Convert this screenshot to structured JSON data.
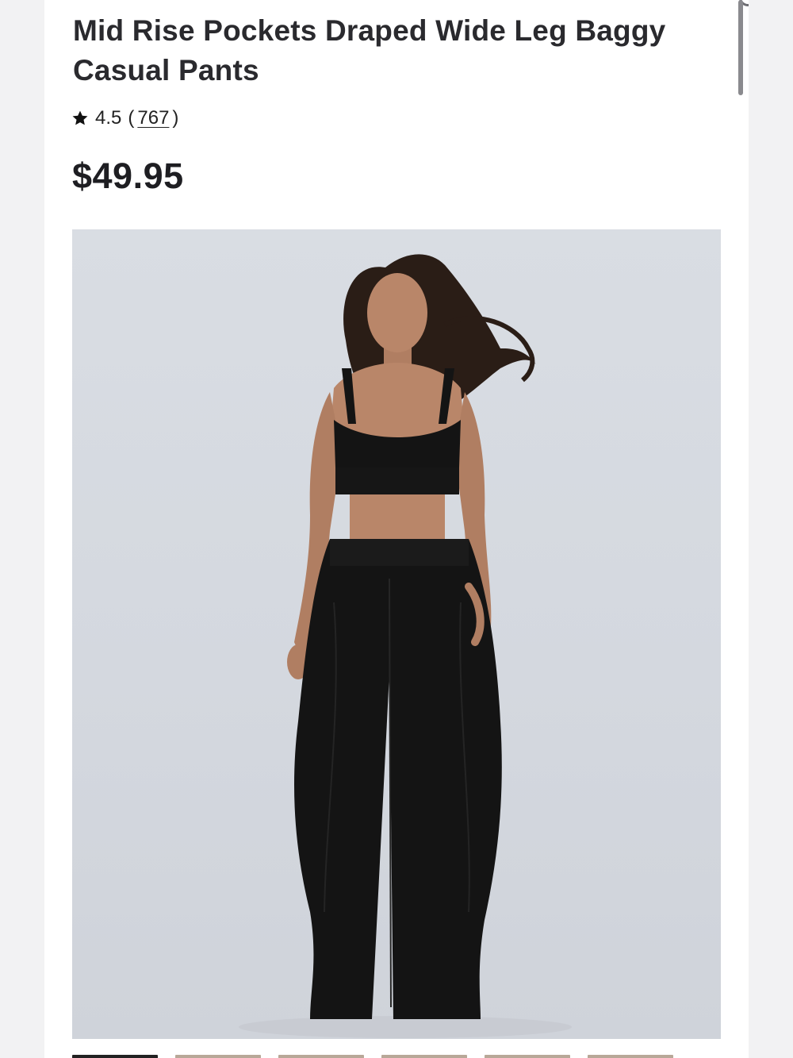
{
  "product": {
    "title": "Mid Rise Pockets Draped Wide Leg Baggy Casual Pants",
    "rating": {
      "icon": "star-icon",
      "value": "4.5",
      "open_paren": "(",
      "count": "767",
      "close_paren": ")"
    },
    "price": "$49.95",
    "image": {
      "alt": "Model wearing black sports bra and black draped wide leg pants",
      "background_color": "#d6dae0"
    },
    "thumbnails": [
      {
        "name": "thumbnail-1",
        "active": true
      },
      {
        "name": "thumbnail-2",
        "active": false
      },
      {
        "name": "thumbnail-3",
        "active": false
      },
      {
        "name": "thumbnail-4",
        "active": false
      },
      {
        "name": "thumbnail-5",
        "active": false
      },
      {
        "name": "thumbnail-6",
        "active": false
      }
    ]
  },
  "colors": {
    "text_primary": "#2a2a2e",
    "page_background": "#f2f2f3",
    "card_background": "#ffffff",
    "garment": "#141414"
  }
}
